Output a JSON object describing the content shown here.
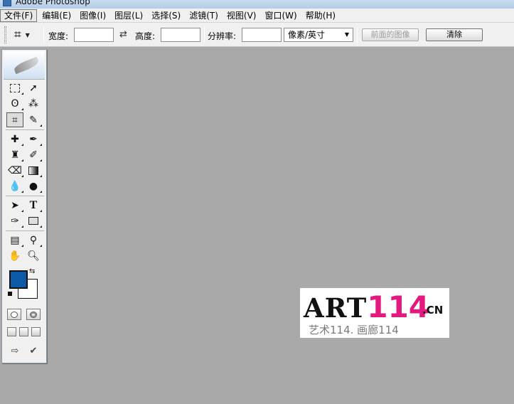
{
  "window": {
    "title": "Adobe Photoshop"
  },
  "menubar": {
    "items": [
      {
        "label": "文件(F)",
        "active": true
      },
      {
        "label": "编辑(E)"
      },
      {
        "label": "图像(I)"
      },
      {
        "label": "图层(L)"
      },
      {
        "label": "选择(S)"
      },
      {
        "label": "滤镜(T)"
      },
      {
        "label": "视图(V)"
      },
      {
        "label": "窗口(W)"
      },
      {
        "label": "帮助(H)"
      }
    ]
  },
  "options": {
    "tool_preset_icon": "crop-icon",
    "width_label": "宽度:",
    "width_value": "",
    "swap_icon": "swap-arrows-icon",
    "height_label": "高度:",
    "height_value": "",
    "resolution_label": "分辨率:",
    "resolution_value": "",
    "unit_selected": "像素/英寸",
    "front_image_label": "前面的图像",
    "clear_label": "清除"
  },
  "toolbox": {
    "foreground_color": "#0b5aa8",
    "background_color": "#ffffff"
  },
  "watermark": {
    "art": "ART",
    "num": "114",
    "domain": ".CN",
    "subtitle": "艺术114. 画廊114"
  }
}
